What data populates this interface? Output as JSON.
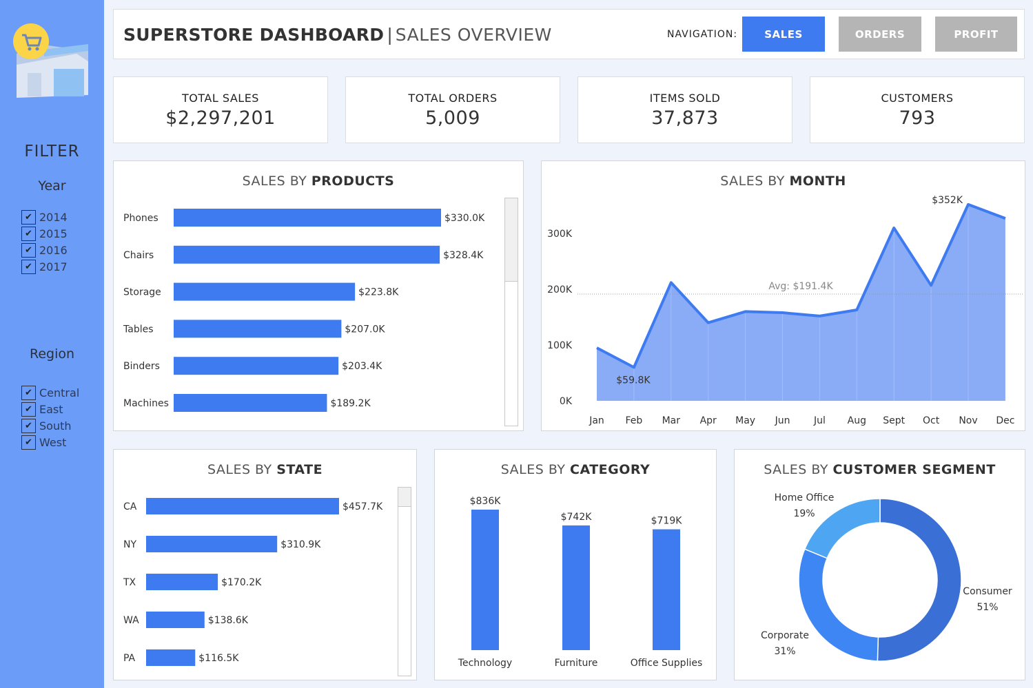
{
  "sidebar": {
    "filter_title": "FILTER",
    "year_title": "Year",
    "years": [
      "2014",
      "2015",
      "2016",
      "2017"
    ],
    "region_title": "Region",
    "regions": [
      "Central",
      "East",
      "South",
      "West"
    ],
    "check_mark": "✔"
  },
  "header": {
    "title_bold": "SUPERSTORE DASHBOARD",
    "separator": "|",
    "title_thin": "SALES OVERVIEW",
    "nav_label": "NAVIGATION:",
    "nav_buttons": [
      "SALES",
      "ORDERS",
      "PROFIT"
    ]
  },
  "kpis": [
    {
      "label": "TOTAL SALES",
      "value": "$2,297,201"
    },
    {
      "label": "TOTAL ORDERS",
      "value": "5,009"
    },
    {
      "label": "ITEMS SOLD",
      "value": "37,873"
    },
    {
      "label": "CUSTOMERS",
      "value": "793"
    }
  ],
  "colors": {
    "accent": "#3f7bf0",
    "sidebar": "#6b9df8",
    "inactive_button": "#b5b5b5",
    "area_fill": "#8aabf5",
    "donut_consumer": "#3a6fd6",
    "donut_corporate": "#3f86f5",
    "donut_home_office": "#4ea6f2"
  },
  "panels": {
    "products": {
      "title_thin": "SALES BY ",
      "title_bold": "PRODUCTS"
    },
    "month": {
      "title_thin": "SALES BY ",
      "title_bold": "MONTH"
    },
    "state": {
      "title_thin": "SALES BY ",
      "title_bold": "STATE"
    },
    "category": {
      "title_thin": "SALES BY ",
      "title_bold": "CATEGORY"
    },
    "segment": {
      "title_thin": "SALES BY ",
      "title_bold": "CUSTOMER SEGMENT"
    }
  },
  "chart_data": [
    {
      "id": "products",
      "type": "bar",
      "orientation": "horizontal",
      "categories": [
        "Phones",
        "Chairs",
        "Storage",
        "Tables",
        "Binders",
        "Machines"
      ],
      "values": [
        330.0,
        328.4,
        223.8,
        207.0,
        203.4,
        189.2
      ],
      "value_labels": [
        "$330.0K",
        "$328.4K",
        "$223.8K",
        "$207.0K",
        "$203.4K",
        "$189.2K"
      ],
      "unit": "K USD",
      "xlim": [
        0,
        330
      ]
    },
    {
      "id": "month",
      "type": "area",
      "categories": [
        "Jan",
        "Feb",
        "Mar",
        "Apr",
        "May",
        "Jun",
        "Jul",
        "Aug",
        "Sept",
        "Oct",
        "Nov",
        "Dec"
      ],
      "values": [
        95,
        60,
        212,
        140,
        160,
        158,
        152,
        163,
        310,
        207,
        352,
        327
      ],
      "y_ticks": [
        "0K",
        "100K",
        "200K",
        "300K"
      ],
      "y_tick_values": [
        0,
        100,
        200,
        300
      ],
      "ylim": [
        0,
        380
      ],
      "average": 191.4,
      "average_label": "Avg: $191.4K",
      "annotations": [
        {
          "category": "Feb",
          "label": "$59.8K"
        },
        {
          "category": "Nov",
          "label": "$352K"
        }
      ]
    },
    {
      "id": "state",
      "type": "bar",
      "orientation": "horizontal",
      "categories": [
        "CA",
        "NY",
        "TX",
        "WA",
        "PA"
      ],
      "values": [
        457.7,
        310.9,
        170.2,
        138.6,
        116.5
      ],
      "value_labels": [
        "$457.7K",
        "$310.9K",
        "$170.2K",
        "$138.6K",
        "$116.5K"
      ],
      "unit": "K USD",
      "xlim": [
        0,
        457.7
      ]
    },
    {
      "id": "category",
      "type": "bar",
      "orientation": "vertical",
      "categories": [
        "Technology",
        "Furniture",
        "Office Supplies"
      ],
      "values": [
        836,
        742,
        719
      ],
      "value_labels": [
        "$836K",
        "$742K",
        "$719K"
      ],
      "unit": "K USD",
      "ylim": [
        0,
        836
      ]
    },
    {
      "id": "segment",
      "type": "pie",
      "style": "donut",
      "categories": [
        "Consumer",
        "Corporate",
        "Home Office"
      ],
      "values": [
        51,
        31,
        19
      ],
      "value_labels": [
        "51%",
        "31%",
        "19%"
      ]
    }
  ]
}
